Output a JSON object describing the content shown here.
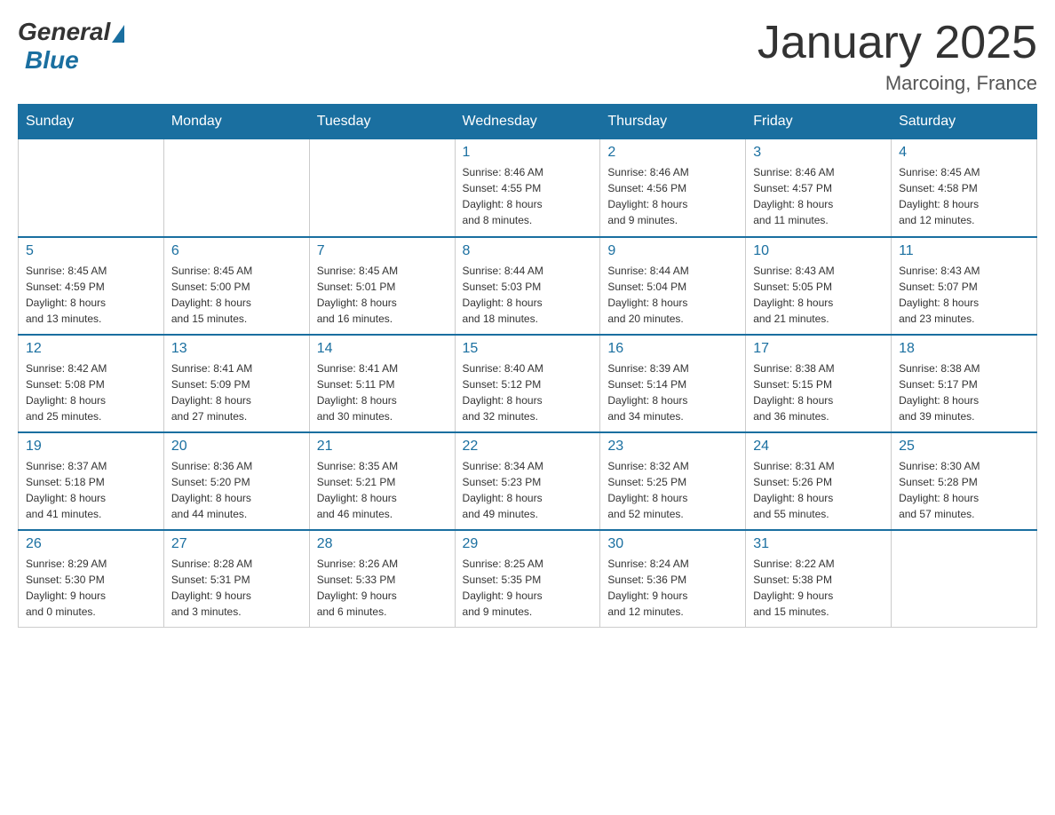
{
  "header": {
    "logo_general": "General",
    "logo_blue": "Blue",
    "title": "January 2025",
    "subtitle": "Marcoing, France"
  },
  "days_of_week": [
    "Sunday",
    "Monday",
    "Tuesday",
    "Wednesday",
    "Thursday",
    "Friday",
    "Saturday"
  ],
  "weeks": [
    [
      {
        "day": "",
        "info": ""
      },
      {
        "day": "",
        "info": ""
      },
      {
        "day": "",
        "info": ""
      },
      {
        "day": "1",
        "info": "Sunrise: 8:46 AM\nSunset: 4:55 PM\nDaylight: 8 hours\nand 8 minutes."
      },
      {
        "day": "2",
        "info": "Sunrise: 8:46 AM\nSunset: 4:56 PM\nDaylight: 8 hours\nand 9 minutes."
      },
      {
        "day": "3",
        "info": "Sunrise: 8:46 AM\nSunset: 4:57 PM\nDaylight: 8 hours\nand 11 minutes."
      },
      {
        "day": "4",
        "info": "Sunrise: 8:45 AM\nSunset: 4:58 PM\nDaylight: 8 hours\nand 12 minutes."
      }
    ],
    [
      {
        "day": "5",
        "info": "Sunrise: 8:45 AM\nSunset: 4:59 PM\nDaylight: 8 hours\nand 13 minutes."
      },
      {
        "day": "6",
        "info": "Sunrise: 8:45 AM\nSunset: 5:00 PM\nDaylight: 8 hours\nand 15 minutes."
      },
      {
        "day": "7",
        "info": "Sunrise: 8:45 AM\nSunset: 5:01 PM\nDaylight: 8 hours\nand 16 minutes."
      },
      {
        "day": "8",
        "info": "Sunrise: 8:44 AM\nSunset: 5:03 PM\nDaylight: 8 hours\nand 18 minutes."
      },
      {
        "day": "9",
        "info": "Sunrise: 8:44 AM\nSunset: 5:04 PM\nDaylight: 8 hours\nand 20 minutes."
      },
      {
        "day": "10",
        "info": "Sunrise: 8:43 AM\nSunset: 5:05 PM\nDaylight: 8 hours\nand 21 minutes."
      },
      {
        "day": "11",
        "info": "Sunrise: 8:43 AM\nSunset: 5:07 PM\nDaylight: 8 hours\nand 23 minutes."
      }
    ],
    [
      {
        "day": "12",
        "info": "Sunrise: 8:42 AM\nSunset: 5:08 PM\nDaylight: 8 hours\nand 25 minutes."
      },
      {
        "day": "13",
        "info": "Sunrise: 8:41 AM\nSunset: 5:09 PM\nDaylight: 8 hours\nand 27 minutes."
      },
      {
        "day": "14",
        "info": "Sunrise: 8:41 AM\nSunset: 5:11 PM\nDaylight: 8 hours\nand 30 minutes."
      },
      {
        "day": "15",
        "info": "Sunrise: 8:40 AM\nSunset: 5:12 PM\nDaylight: 8 hours\nand 32 minutes."
      },
      {
        "day": "16",
        "info": "Sunrise: 8:39 AM\nSunset: 5:14 PM\nDaylight: 8 hours\nand 34 minutes."
      },
      {
        "day": "17",
        "info": "Sunrise: 8:38 AM\nSunset: 5:15 PM\nDaylight: 8 hours\nand 36 minutes."
      },
      {
        "day": "18",
        "info": "Sunrise: 8:38 AM\nSunset: 5:17 PM\nDaylight: 8 hours\nand 39 minutes."
      }
    ],
    [
      {
        "day": "19",
        "info": "Sunrise: 8:37 AM\nSunset: 5:18 PM\nDaylight: 8 hours\nand 41 minutes."
      },
      {
        "day": "20",
        "info": "Sunrise: 8:36 AM\nSunset: 5:20 PM\nDaylight: 8 hours\nand 44 minutes."
      },
      {
        "day": "21",
        "info": "Sunrise: 8:35 AM\nSunset: 5:21 PM\nDaylight: 8 hours\nand 46 minutes."
      },
      {
        "day": "22",
        "info": "Sunrise: 8:34 AM\nSunset: 5:23 PM\nDaylight: 8 hours\nand 49 minutes."
      },
      {
        "day": "23",
        "info": "Sunrise: 8:32 AM\nSunset: 5:25 PM\nDaylight: 8 hours\nand 52 minutes."
      },
      {
        "day": "24",
        "info": "Sunrise: 8:31 AM\nSunset: 5:26 PM\nDaylight: 8 hours\nand 55 minutes."
      },
      {
        "day": "25",
        "info": "Sunrise: 8:30 AM\nSunset: 5:28 PM\nDaylight: 8 hours\nand 57 minutes."
      }
    ],
    [
      {
        "day": "26",
        "info": "Sunrise: 8:29 AM\nSunset: 5:30 PM\nDaylight: 9 hours\nand 0 minutes."
      },
      {
        "day": "27",
        "info": "Sunrise: 8:28 AM\nSunset: 5:31 PM\nDaylight: 9 hours\nand 3 minutes."
      },
      {
        "day": "28",
        "info": "Sunrise: 8:26 AM\nSunset: 5:33 PM\nDaylight: 9 hours\nand 6 minutes."
      },
      {
        "day": "29",
        "info": "Sunrise: 8:25 AM\nSunset: 5:35 PM\nDaylight: 9 hours\nand 9 minutes."
      },
      {
        "day": "30",
        "info": "Sunrise: 8:24 AM\nSunset: 5:36 PM\nDaylight: 9 hours\nand 12 minutes."
      },
      {
        "day": "31",
        "info": "Sunrise: 8:22 AM\nSunset: 5:38 PM\nDaylight: 9 hours\nand 15 minutes."
      },
      {
        "day": "",
        "info": ""
      }
    ]
  ]
}
